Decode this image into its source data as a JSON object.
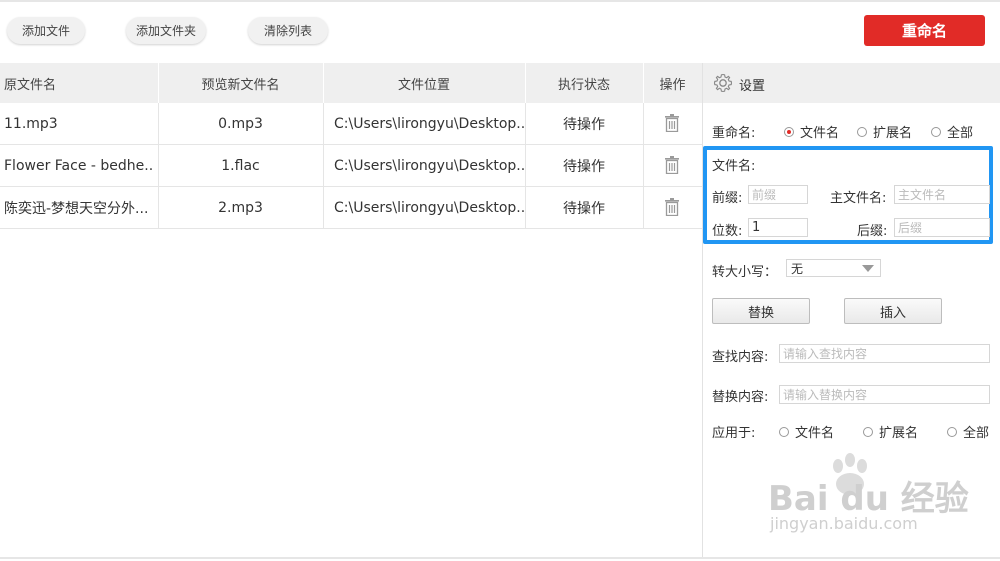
{
  "toolbar": {
    "add_file": "添加文件",
    "add_folder": "添加文件夹",
    "clear_list": "清除列表",
    "rename": "重命名"
  },
  "table": {
    "headers": [
      "原文件名",
      "预览新文件名",
      "文件位置",
      "执行状态",
      "操作"
    ],
    "rows": [
      {
        "original": "11.mp3",
        "preview": "0.mp3",
        "location": "C:\\Users\\lirongyu\\Desktop...",
        "status": "待操作"
      },
      {
        "original": "Flower Face - bedhe...",
        "preview": "1.flac",
        "location": "C:\\Users\\lirongyu\\Desktop...",
        "status": "待操作"
      },
      {
        "original": "陈奕迅-梦想天空分外...",
        "preview": "2.mp3",
        "location": "C:\\Users\\lirongyu\\Desktop...",
        "status": "待操作"
      }
    ]
  },
  "settings": {
    "title": "设置",
    "rename_label": "重命名:",
    "rename_options": [
      "文件名",
      "扩展名",
      "全部"
    ],
    "rename_selected": "文件名",
    "filename_section": "文件名:",
    "prefix_label": "前缀:",
    "prefix_placeholder": "前缀",
    "main_label": "主文件名:",
    "main_placeholder": "主文件名",
    "digits_label": "位数:",
    "digits_value": "1",
    "suffix_label": "后缀:",
    "suffix_placeholder": "后缀",
    "case_label": "转大小写：",
    "case_value": "无",
    "replace_button": "替换",
    "insert_button": "插入",
    "find_label": "查找内容:",
    "find_placeholder": "请输入查找内容",
    "replace_label": "替换内容:",
    "replace_placeholder": "请输入替换内容",
    "apply_label": "应用于:",
    "apply_options": [
      "文件名",
      "扩展名",
      "全部"
    ]
  },
  "watermark": {
    "brand": "Bai du 经验",
    "url": "jingyan.baidu.com"
  },
  "colors": {
    "accent": "#e12b27",
    "highlight": "#2196f3"
  }
}
